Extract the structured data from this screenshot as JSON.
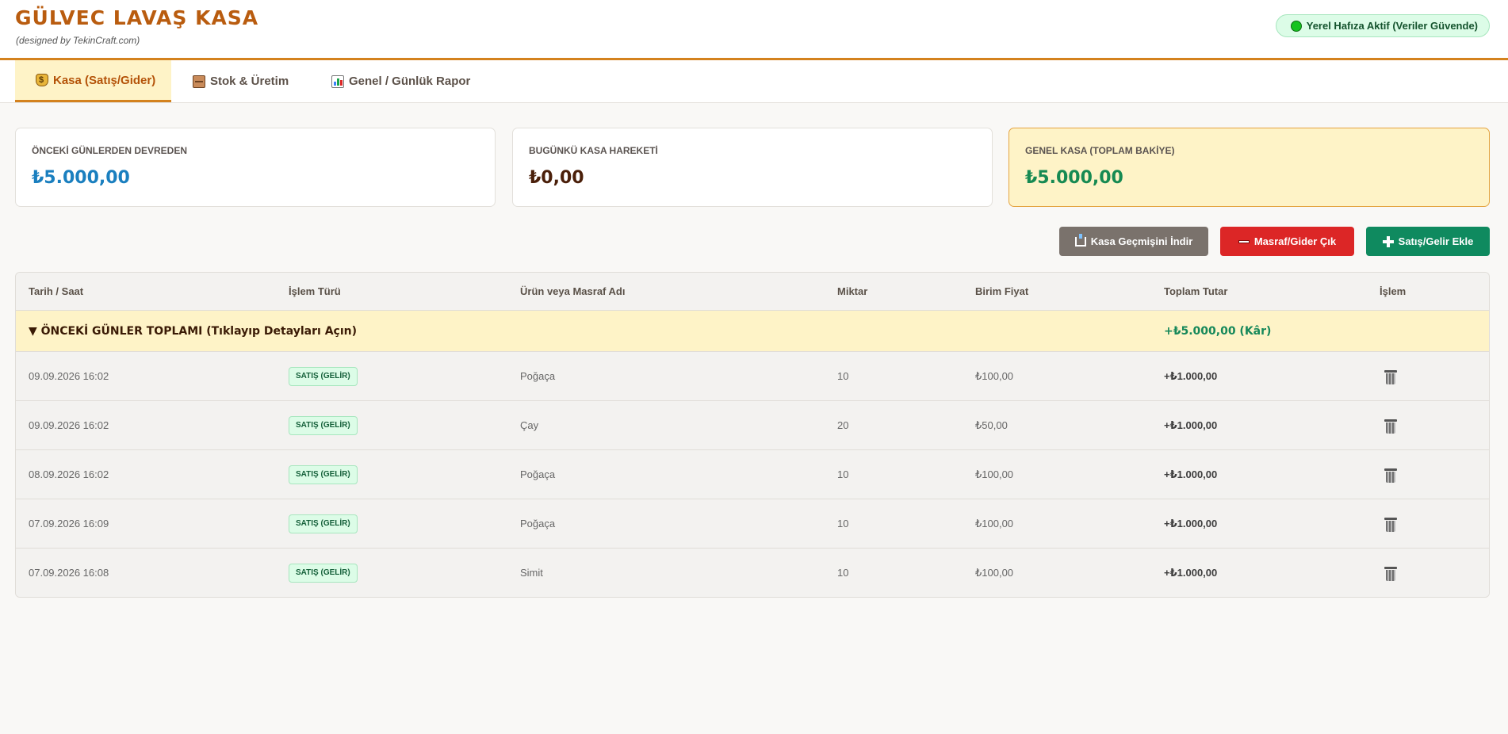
{
  "app": {
    "title": "GÜLVEC LAVAŞ KASA",
    "subtitle": "(designed by TekinCraft.com)",
    "status": "Yerel Hafıza Aktif (Veriler Güvende)"
  },
  "tabs": [
    {
      "label": "Kasa (Satış/Gider)",
      "icon": "money-bag-icon",
      "active": true
    },
    {
      "label": "Stok & Üretim",
      "icon": "box-icon",
      "active": false
    },
    {
      "label": "Genel / Günlük Rapor",
      "icon": "bar-chart-icon",
      "active": false
    }
  ],
  "cards": [
    {
      "label": "ÖNCEKİ GÜNLERDEN DEVREDEN",
      "value": "₺5.000,00",
      "color": "#1a7fbf"
    },
    {
      "label": "BUGÜNKÜ KASA HAREKETİ",
      "value": "₺0,00",
      "color": "#4a1f0a"
    },
    {
      "label": "GENEL KASA (TOPLAM BAKİYE)",
      "value": "₺5.000,00",
      "color": "#168a52"
    }
  ],
  "actions": {
    "download": "Kasa Geçmişini İndir",
    "expense": "Masraf/Gider Çık",
    "income": "Satış/Gelir Ekle"
  },
  "colors": {
    "accent": "#d4821e",
    "brand": "#b95c0f",
    "download_btn": "#7a726c",
    "expense_btn": "#dc2626",
    "income_btn": "#0f8a5f"
  },
  "table": {
    "headers": [
      "Tarih / Saat",
      "İşlem Türü",
      "Ürün veya Masraf Adı",
      "Miktar",
      "Birim Fiyat",
      "Toplam Tutar",
      "İşlem"
    ],
    "group": {
      "label": "▼ ÖNCEKİ GÜNLER TOPLAMI (Tıklayıp Detayları Açın)",
      "total": "+₺5.000,00 (Kâr)"
    },
    "rows": [
      {
        "date": "09.09.2026 16:02",
        "type": "SATIŞ (GELİR)",
        "name": "Poğaça",
        "qty": "10",
        "unit": "₺100,00",
        "total": "+₺1.000,00"
      },
      {
        "date": "09.09.2026 16:02",
        "type": "SATIŞ (GELİR)",
        "name": "Çay",
        "qty": "20",
        "unit": "₺50,00",
        "total": "+₺1.000,00"
      },
      {
        "date": "08.09.2026 16:02",
        "type": "SATIŞ (GELİR)",
        "name": "Poğaça",
        "qty": "10",
        "unit": "₺100,00",
        "total": "+₺1.000,00"
      },
      {
        "date": "07.09.2026 16:09",
        "type": "SATIŞ (GELİR)",
        "name": "Poğaça",
        "qty": "10",
        "unit": "₺100,00",
        "total": "+₺1.000,00"
      },
      {
        "date": "07.09.2026 16:08",
        "type": "SATIŞ (GELİR)",
        "name": "Simit",
        "qty": "10",
        "unit": "₺100,00",
        "total": "+₺1.000,00"
      }
    ]
  }
}
